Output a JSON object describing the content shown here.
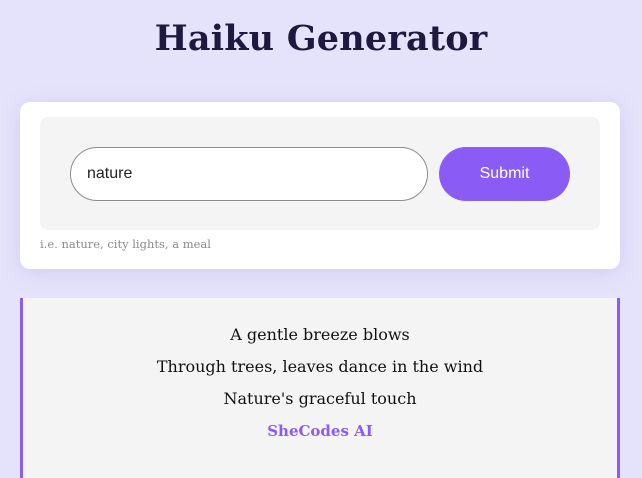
{
  "header": {
    "title": "Haiku Generator"
  },
  "form": {
    "input_value": "nature",
    "submit_label": "Submit",
    "hint": "i.e. nature, city lights, a meal"
  },
  "poem": {
    "lines": [
      "A gentle breeze blows",
      "Through trees, leaves dance in the wind",
      "Nature's graceful touch"
    ],
    "signature": "SheCodes AI"
  },
  "colors": {
    "background": "#e5e3fb",
    "accent": "#8a5cf5",
    "title": "#20193f",
    "panel": "#f4f4f4"
  }
}
